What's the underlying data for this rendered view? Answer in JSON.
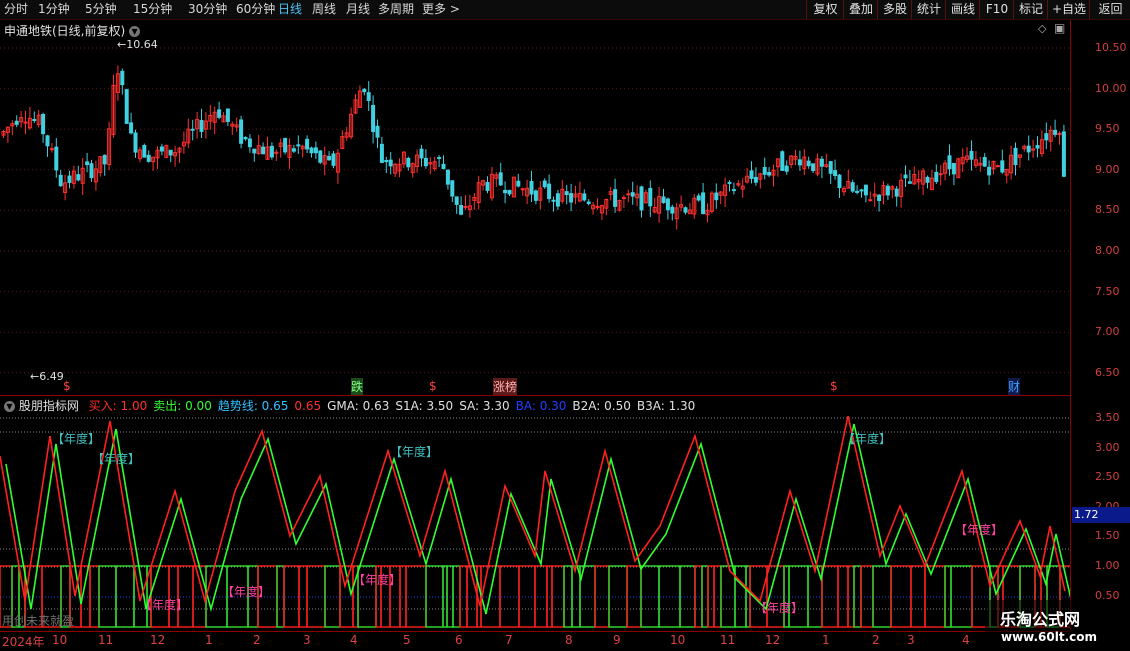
{
  "topbar": {
    "periods": [
      "分时",
      "1分钟",
      "5分钟",
      "15分钟",
      "30分钟",
      "60分钟",
      "日线",
      "周线",
      "月线",
      "多周期",
      "更多 >"
    ],
    "active": "日线",
    "buttons": [
      "复权",
      "叠加",
      "多股",
      "统计",
      "画线",
      "F10",
      "标记",
      "+自选",
      "返回"
    ]
  },
  "price_panel": {
    "title": "申通地铁(日线,前复权)",
    "high_label": "10.64",
    "low_label": "6.49",
    "y_ticks": [
      "10.50",
      "10.00",
      "9.50",
      "9.00",
      "8.50",
      "8.00",
      "7.50",
      "7.00",
      "6.50"
    ],
    "markers": [
      {
        "text": "$",
        "color": "#ff4040"
      },
      {
        "text": "跌",
        "color": "#80ff80"
      },
      {
        "text": "$",
        "color": "#ff4040"
      },
      {
        "text": "涨榜",
        "color": "#ffb0b0"
      },
      {
        "text": "$",
        "color": "#ff4040"
      },
      {
        "text": "财",
        "color": "#40a0ff"
      }
    ]
  },
  "indicator_panel": {
    "name": "股朋指标网",
    "params": [
      {
        "label": "买入:",
        "value": "1.00",
        "color": "#ff3030"
      },
      {
        "label": "卖出:",
        "value": "0.00",
        "color": "#30ff30"
      },
      {
        "label": "趋势线:",
        "value": "0.65",
        "color": "#30c0ff"
      },
      {
        "label": "",
        "value": "0.65",
        "color": "#ff3030"
      },
      {
        "label": "GMA:",
        "value": "0.63",
        "color": "#e0e0e0"
      },
      {
        "label": "S1A:",
        "value": "3.50",
        "color": "#e0e0e0"
      },
      {
        "label": "SA:",
        "value": "3.30",
        "color": "#e0e0e0"
      },
      {
        "label": "BA:",
        "value": "0.30",
        "color": "#2040ff"
      },
      {
        "label": "B2A:",
        "value": "0.50",
        "color": "#e0e0e0"
      },
      {
        "label": "B3A:",
        "value": "1.30",
        "color": "#e0e0e0"
      }
    ],
    "y_ticks": [
      "3.50",
      "3.00",
      "2.50",
      "2.00",
      "1.50",
      "1.00",
      "0.50"
    ],
    "current_value": "1.72",
    "footer_text": "用创未来就盈",
    "labels": [
      {
        "text": "【年度】",
        "color": "#40c0c0"
      },
      {
        "text": "【年度】",
        "color": "#40c0c0"
      },
      {
        "text": "【年度】",
        "color": "#ff40a0"
      },
      {
        "text": "【年度】",
        "color": "#ff40a0"
      },
      {
        "text": "【年度】",
        "color": "#40c0c0"
      },
      {
        "text": "【年度】",
        "color": "#ff40a0"
      },
      {
        "text": "【年度】",
        "color": "#ff40a0"
      },
      {
        "text": "【年度】",
        "color": "#40c0c0"
      },
      {
        "text": "【年度】",
        "color": "#ff40a0"
      }
    ]
  },
  "x_axis": {
    "labels": [
      "2024年",
      "10",
      "11",
      "12",
      "1",
      "2",
      "3",
      "4",
      "5",
      "6",
      "7",
      "8",
      "9",
      "10",
      "11",
      "12",
      "1",
      "2",
      "3",
      "4"
    ]
  },
  "watermark": {
    "line1": "乐淘公式网",
    "line2": "www.60lt.com"
  },
  "colors": {
    "up": "#ff3030",
    "down": "#40d0e0",
    "axis": "#8b0000",
    "buy": "#ff2020",
    "sell": "#30e030"
  }
}
